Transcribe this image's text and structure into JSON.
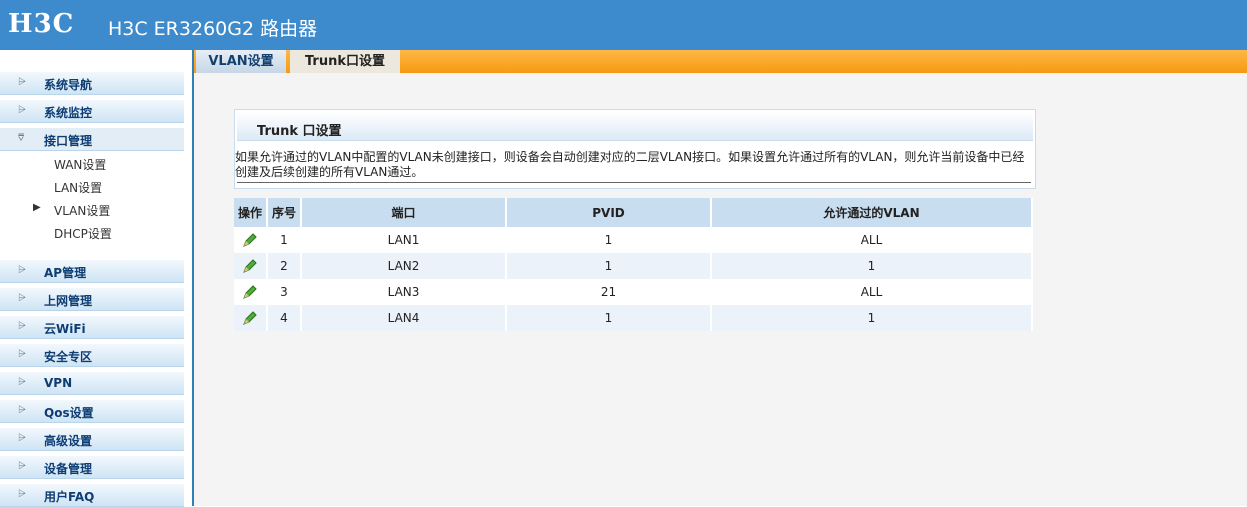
{
  "header": {
    "logo": "H3C",
    "title": "H3C ER3260G2 路由器",
    "bg_color": "#3d8bcc"
  },
  "sidebar": {
    "items_top": [
      {
        "label": "系统导航",
        "icon": "chevron-right-icon"
      },
      {
        "label": "系统监控",
        "icon": "chevron-right-icon"
      },
      {
        "label": "接口管理",
        "icon": "chevron-down-icon"
      }
    ],
    "sub_items": [
      {
        "label": "WAN设置"
      },
      {
        "label": "LAN设置"
      },
      {
        "label": "VLAN设置",
        "arrow": "▶"
      },
      {
        "label": "DHCP设置"
      }
    ],
    "items_bottom": [
      {
        "label": "AP管理"
      },
      {
        "label": "上网管理"
      },
      {
        "label": "云WiFi"
      },
      {
        "label": "安全专区"
      },
      {
        "label": "VPN"
      },
      {
        "label": "Qos设置"
      },
      {
        "label": "高级设置"
      },
      {
        "label": "设备管理"
      },
      {
        "label": "用户FAQ"
      }
    ]
  },
  "tabs": [
    {
      "label": "VLAN设置",
      "state": "inactive"
    },
    {
      "label": "Trunk口设置",
      "state": "active"
    }
  ],
  "panel": {
    "title": "Trunk 口设置",
    "description": "如果允许通过的VLAN中配置的VLAN未创建接口，则设备会自动创建对应的二层VLAN接口。如果设置允许通过所有的VLAN，则允许当前设备中已经创建及后续创建的所有VLAN通过。"
  },
  "table": {
    "headers": [
      "操作",
      "序号",
      "端口",
      "PVID",
      "允许通过的VLAN"
    ],
    "rows": [
      {
        "index": "1",
        "port": "LAN1",
        "pvid": "1",
        "allowed_vlan": "ALL"
      },
      {
        "index": "2",
        "port": "LAN2",
        "pvid": "1",
        "allowed_vlan": "1"
      },
      {
        "index": "3",
        "port": "LAN3",
        "pvid": "21",
        "allowed_vlan": "ALL"
      },
      {
        "index": "4",
        "port": "LAN4",
        "pvid": "1",
        "allowed_vlan": "1"
      }
    ],
    "edit_icon": "pencil-edit-icon"
  },
  "colors": {
    "tab_strip": "#f59a12",
    "table_header": "#c8ddef",
    "nav_text": "#0d3d73"
  }
}
